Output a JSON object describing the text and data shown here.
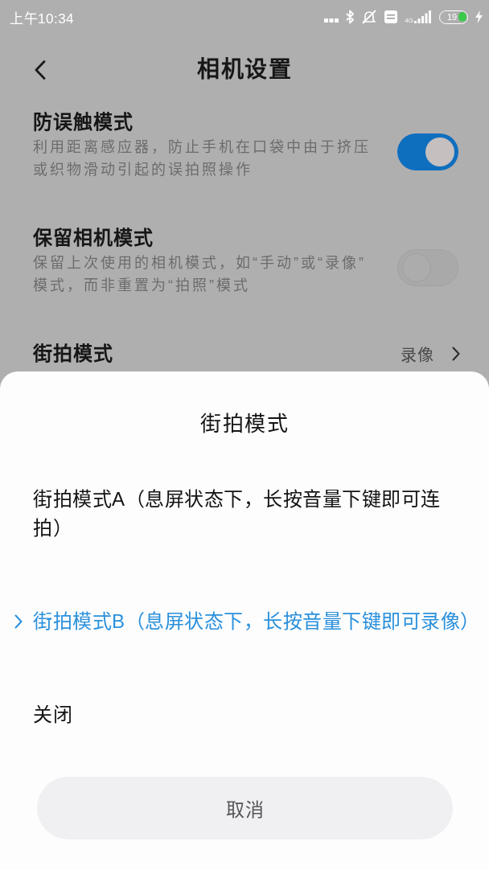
{
  "status_bar": {
    "time": "上午10:34",
    "network": "4G",
    "battery": "19"
  },
  "header": {
    "title": "相机设置"
  },
  "settings": [
    {
      "kind": "toggle",
      "title": "防误触模式",
      "description": "利用距离感应器，防止手机在口袋中由于挤压或织物滑动引起的误拍照操作",
      "on": true
    },
    {
      "kind": "toggle",
      "title": "保留相机模式",
      "description": "保留上次使用的相机模式，如“手动”或“录像”模式，而非重置为“拍照”模式",
      "on": false
    },
    {
      "kind": "value",
      "title": "街拍模式",
      "value": "录像"
    }
  ],
  "sheet": {
    "title": "街拍模式",
    "options": [
      {
        "label": "街拍模式A（息屏状态下，长按音量下键即可连拍）",
        "selected": false
      },
      {
        "label": "街拍模式B（息屏状态下，长按音量下键即可录像）",
        "selected": true
      },
      {
        "label": "关闭",
        "selected": false
      }
    ],
    "cancel": "取消"
  }
}
